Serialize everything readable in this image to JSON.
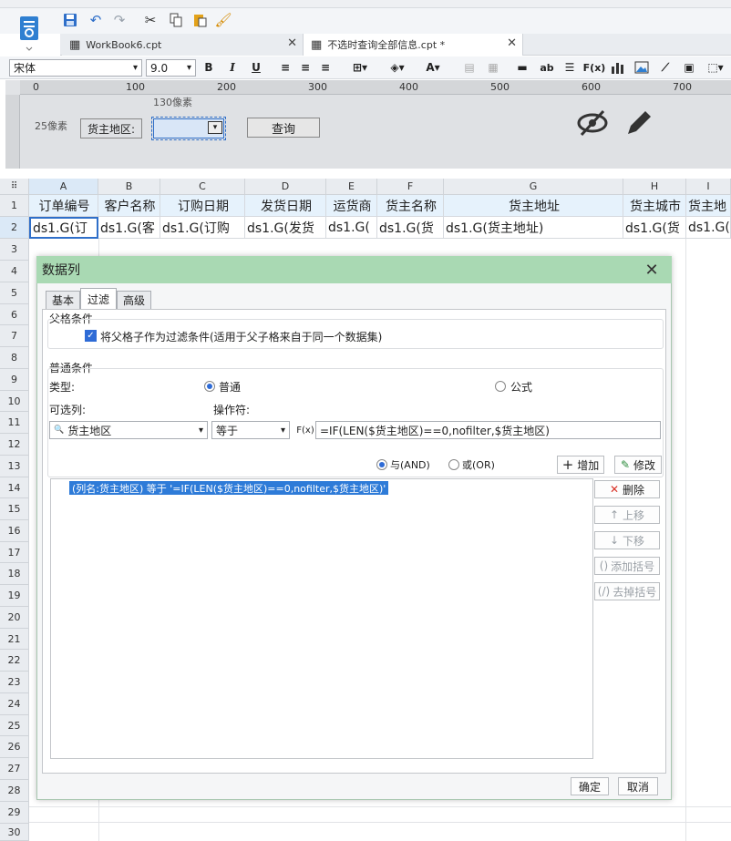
{
  "tabs": [
    {
      "label": "WorkBook6.cpt"
    },
    {
      "label": "不选时查询全部信息.cpt *"
    }
  ],
  "font": {
    "name": "宋体",
    "size": "9.0"
  },
  "ruler": {
    "h": [
      "0",
      "100",
      "200",
      "300",
      "400",
      "500",
      "600",
      "700"
    ]
  },
  "designer": {
    "size_h": "130像素",
    "size_v": "25像素",
    "param_label": "货主地区:",
    "query_button": "查询"
  },
  "sheet": {
    "columns": [
      "A",
      "B",
      "C",
      "D",
      "E",
      "F",
      "G",
      "H",
      "I"
    ],
    "row1": [
      "订单编号",
      "客户名称",
      "订购日期",
      "发货日期",
      "运货商",
      "货主名称",
      "货主地址",
      "货主城市",
      "货主地"
    ],
    "row2": [
      "ds1.G(订",
      "ds1.G(客",
      "ds1.G(订购",
      "ds1.G(发货",
      "ds1.G(",
      "ds1.G(货",
      "ds1.G(货主地址)",
      "ds1.G(货",
      "ds1.G("
    ],
    "row_numbers": [
      "1",
      "2",
      "3",
      "4",
      "5",
      "6",
      "7",
      "8",
      "9",
      "10",
      "11",
      "12",
      "13",
      "14",
      "15",
      "16",
      "17",
      "18",
      "19",
      "20",
      "21",
      "22",
      "23",
      "24",
      "25",
      "26",
      "27",
      "28",
      "29",
      "30"
    ]
  },
  "dialog": {
    "title": "数据列",
    "tabs": [
      "基本",
      "过滤",
      "高级"
    ],
    "parent_section": "父格条件",
    "parent_checkbox": "将父格子作为过滤条件(适用于父子格来自于同一个数据集)",
    "normal_section": "普通条件",
    "type_label": "类型:",
    "type_normal": "普通",
    "type_formula": "公式",
    "column_label": "可选列:",
    "operator_label": "操作符:",
    "column_value": "货主地区",
    "operator_value": "等于",
    "formula_value": "=IF(LEN($货主地区)==0,nofilter,$货主地区)",
    "and_label": "与(AND)",
    "or_label": "或(OR)",
    "add_button": "增加",
    "modify_button": "修改",
    "delete_button": "删除",
    "up_button": "上移",
    "down_button": "下移",
    "add_bracket": "添加括号",
    "remove_bracket": "去掉括号",
    "condition": "(列名:货主地区) 等于 '=IF(LEN($货主地区)==0,nofilter,$货主地区)'",
    "ok": "确定",
    "cancel": "取消"
  }
}
